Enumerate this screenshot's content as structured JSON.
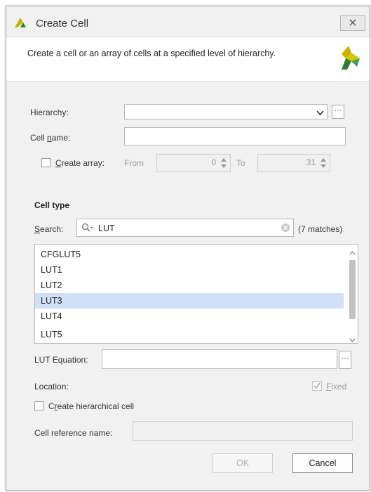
{
  "window": {
    "title": "Create Cell",
    "banner_text": "Create a cell or an array of cells at a specified level of hierarchy."
  },
  "form": {
    "hierarchy_label": "Hierarchy:",
    "hierarchy_value": "",
    "cell_name_label_pre": "Cell ",
    "cell_name_label_ul": "n",
    "cell_name_label_post": "ame:",
    "cell_name_value": "",
    "create_array_ul": "C",
    "create_array_post": "reate array:",
    "from_label": "From",
    "from_value": "0",
    "to_label": "To",
    "to_value": "31"
  },
  "cell_type": {
    "section_title": "Cell type",
    "search_ul": "S",
    "search_post": "earch:",
    "search_value": "LUT",
    "matches": "(7 matches)",
    "items": [
      "CFGLUT5",
      "LUT1",
      "LUT2",
      "LUT3",
      "LUT4",
      "LUT5"
    ],
    "selected": "LUT3"
  },
  "lut": {
    "equation_label": "LUT Equation:",
    "equation_value": "",
    "location_label": "Location:",
    "fixed_ul": "F",
    "fixed_post": "ixed",
    "fixed_checked": true,
    "hier_pre": "C",
    "hier_ul": "r",
    "hier_post": "eate hierarchical cell",
    "ref_name_label": "Cell reference name:",
    "ref_name_value": ""
  },
  "buttons": {
    "ok": "OK",
    "cancel": "Cancel"
  },
  "colors": {
    "accent_select": "#cfe0f7",
    "logo_yellow": "#c8b400",
    "logo_green": "#2e7d32"
  }
}
